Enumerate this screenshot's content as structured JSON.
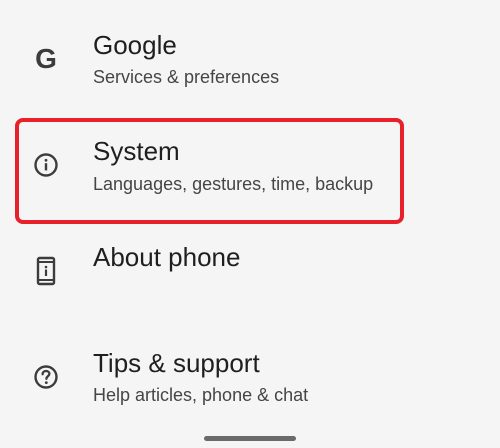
{
  "settings": {
    "items": [
      {
        "id": "google",
        "icon": "google-g-icon",
        "icon_glyph": "G",
        "title": "Google",
        "summary": "Services & preferences"
      },
      {
        "id": "system",
        "icon": "info-icon",
        "title": "System",
        "summary": "Languages, gestures, time, backup"
      },
      {
        "id": "about",
        "icon": "phone-info-icon",
        "title": "About phone",
        "summary": ""
      },
      {
        "id": "tips",
        "icon": "help-circle-icon",
        "title": "Tips & support",
        "summary": "Help articles, phone & chat"
      }
    ]
  },
  "highlight": {
    "target": "system",
    "color": "#e8202a"
  },
  "colors": {
    "background": "#f5f5f5",
    "title_text": "#1f1f1f",
    "summary_text": "#454545",
    "icon": "#3c3c3c"
  }
}
